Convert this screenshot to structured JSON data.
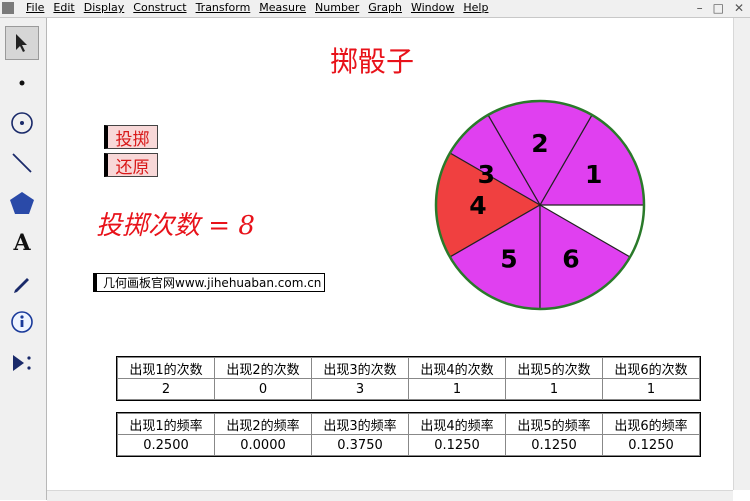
{
  "menu": [
    "File",
    "Edit",
    "Display",
    "Construct",
    "Transform",
    "Measure",
    "Number",
    "Graph",
    "Window",
    "Help"
  ],
  "window_buttons": [
    "–",
    "□",
    "✕"
  ],
  "toolbox": [
    "arrow-select-tool",
    "point-tool",
    "compass-tool",
    "straightedge-tool",
    "polygon-tool",
    "text-tool",
    "marker-tool",
    "information-tool",
    "custom-tool"
  ],
  "title": "掷骰子",
  "buttons": {
    "throw": "投掷",
    "reset": "还原"
  },
  "count_label": "投掷次数 = 8",
  "website": "几何画板官网www.jihehuaban.com.cn",
  "wheel": {
    "segments": [
      "1",
      "2",
      "3",
      "4",
      "5",
      "6"
    ],
    "highlighted": "4",
    "colors": {
      "fill": "#e040f0",
      "highlight": "#f04040",
      "border": "#2a7a2a"
    }
  },
  "counts_table": {
    "headers": [
      "出现1的次数",
      "出现2的次数",
      "出现3的次数",
      "出现4的次数",
      "出现5的次数",
      "出现6的次数"
    ],
    "values": [
      "2",
      "0",
      "3",
      "1",
      "1",
      "1"
    ]
  },
  "freq_table": {
    "headers": [
      "出现1的频率",
      "出现2的频率",
      "出现3的频率",
      "出现4的频率",
      "出现5的频率",
      "出现6的频率"
    ],
    "values": [
      "0.2500",
      "0.0000",
      "0.3750",
      "0.1250",
      "0.1250",
      "0.1250"
    ]
  }
}
